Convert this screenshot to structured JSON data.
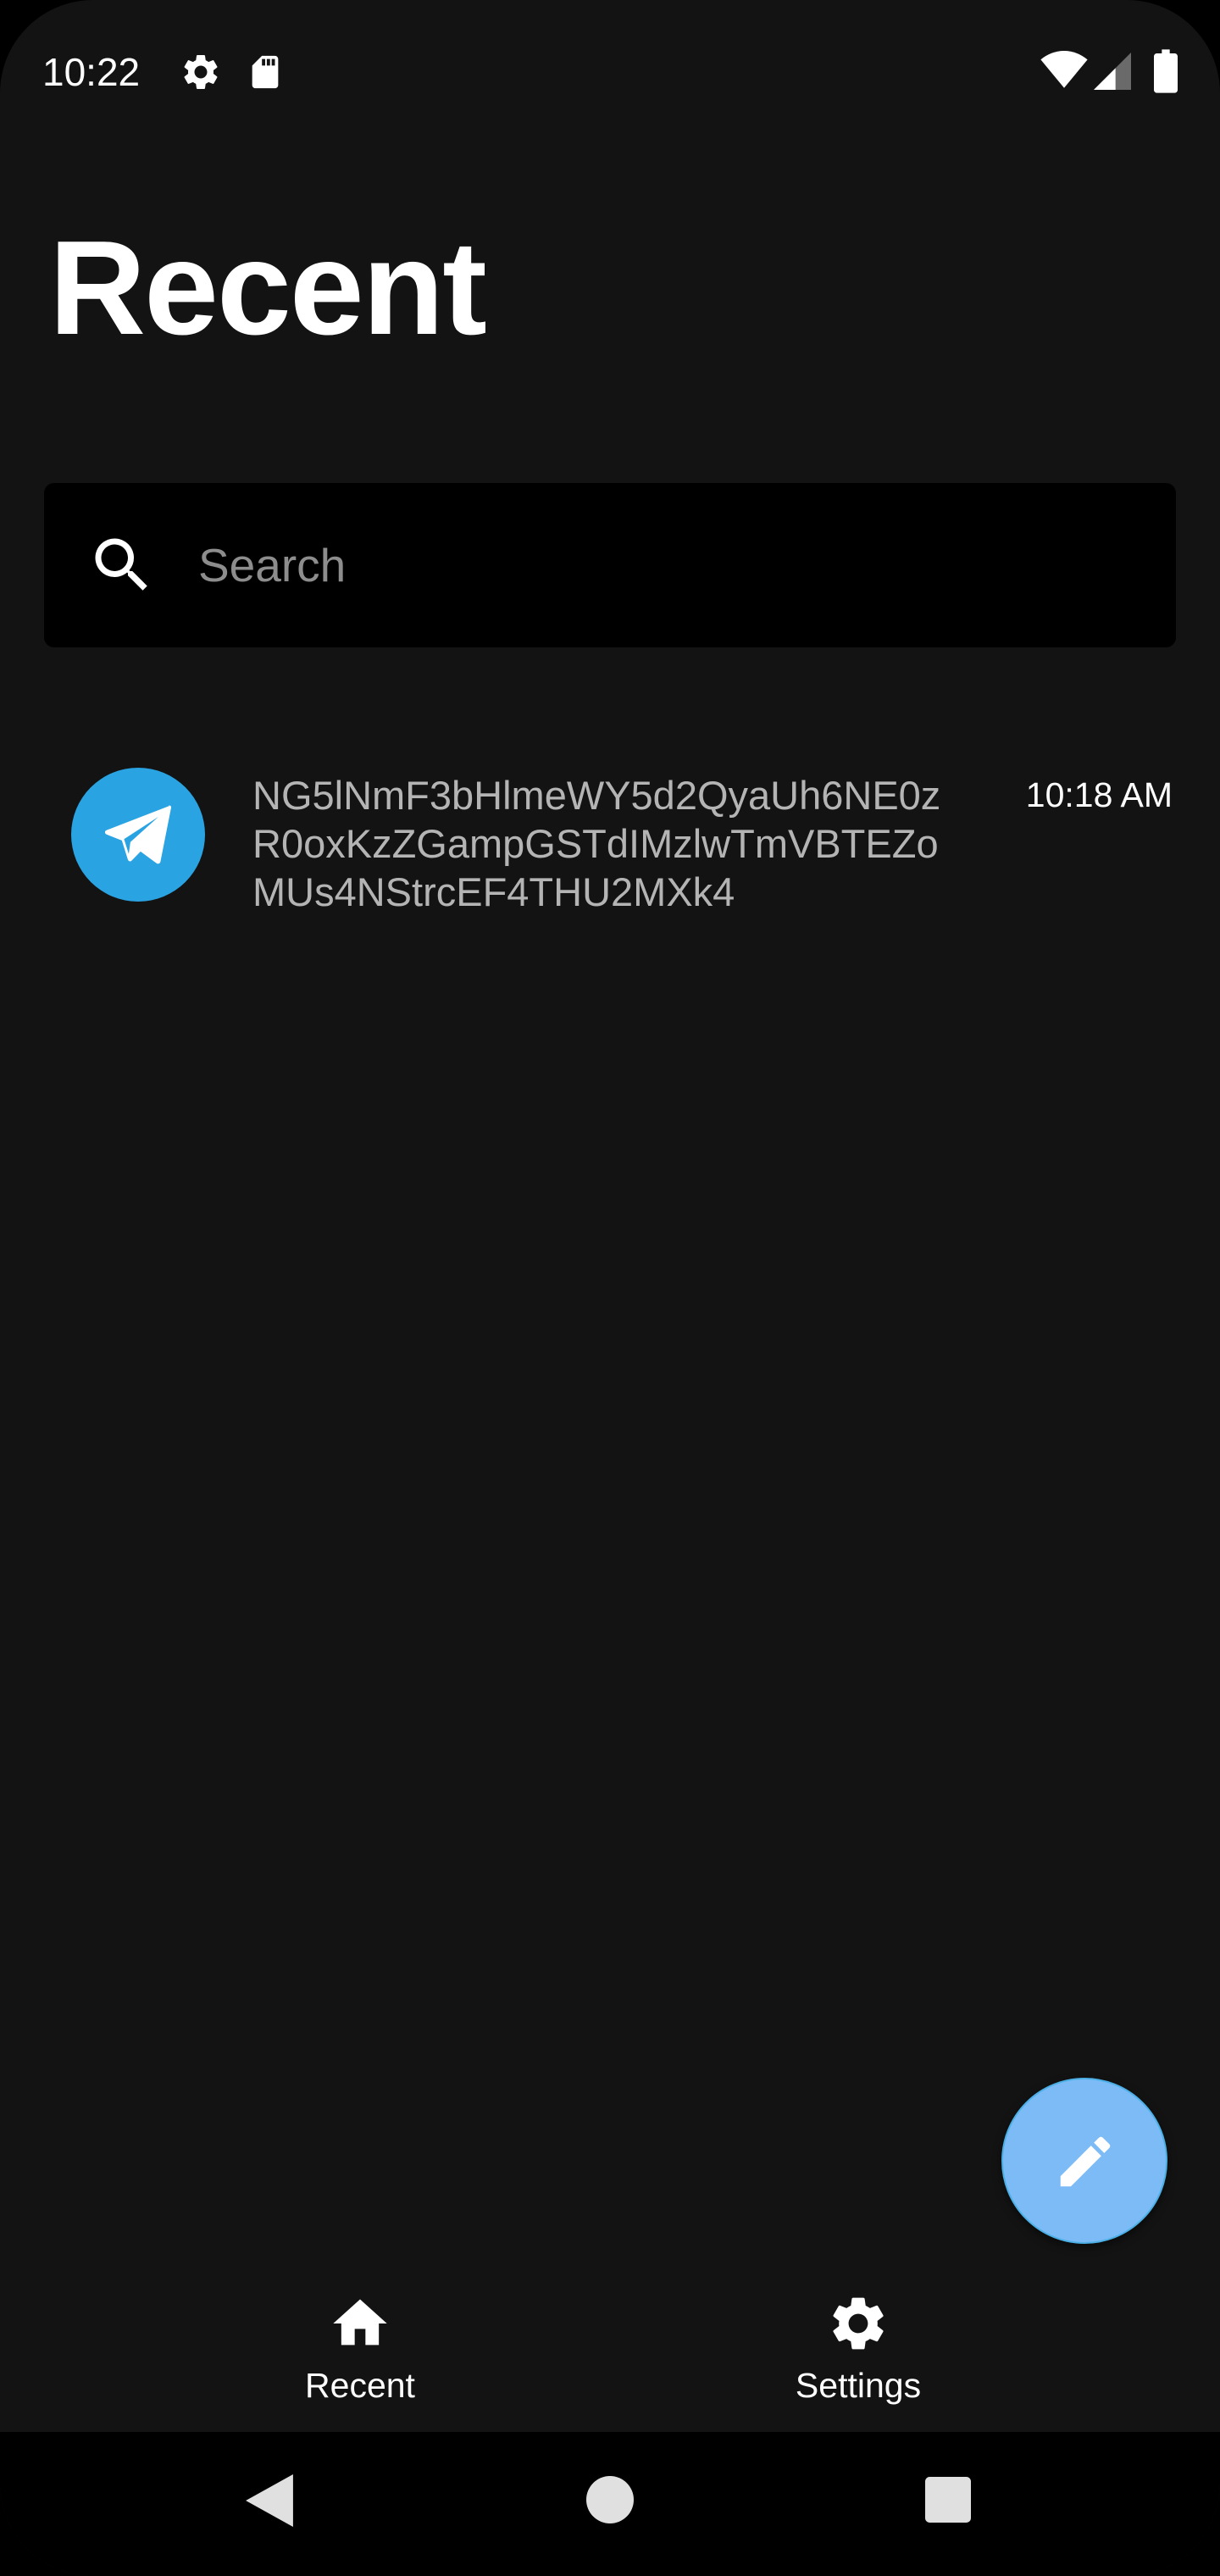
{
  "status_bar": {
    "time": "10:22",
    "icons": [
      "gear-icon",
      "sd-card-icon",
      "wifi-icon",
      "signal-icon",
      "battery-icon"
    ]
  },
  "page": {
    "title": "Recent"
  },
  "search": {
    "placeholder": "Search",
    "value": ""
  },
  "conversations": [
    {
      "avatar_icon": "telegram-send-icon",
      "avatar_color": "#2aa3e2",
      "preview_lines": [
        "NG5lNmF3bHlmeWY5d2QyaUh6NE0z",
        "R0oxKzZGampGSTdIMzlwTmVBTEZo",
        "MUs4NStrcEF4THU2MXk4"
      ],
      "time": "10:18 AM"
    }
  ],
  "fab": {
    "icon": "pencil-icon",
    "color": "#7dbbf7"
  },
  "bottom_nav": {
    "items": [
      {
        "label": "Recent",
        "icon": "home-icon"
      },
      {
        "label": "Settings",
        "icon": "gear-icon"
      }
    ]
  },
  "system_nav": {
    "icons": [
      "back-icon",
      "home-circle-icon",
      "recents-square-icon"
    ]
  },
  "colors": {
    "background": "#131313",
    "search_bg": "#000000",
    "accent": "#2aa3e2"
  }
}
